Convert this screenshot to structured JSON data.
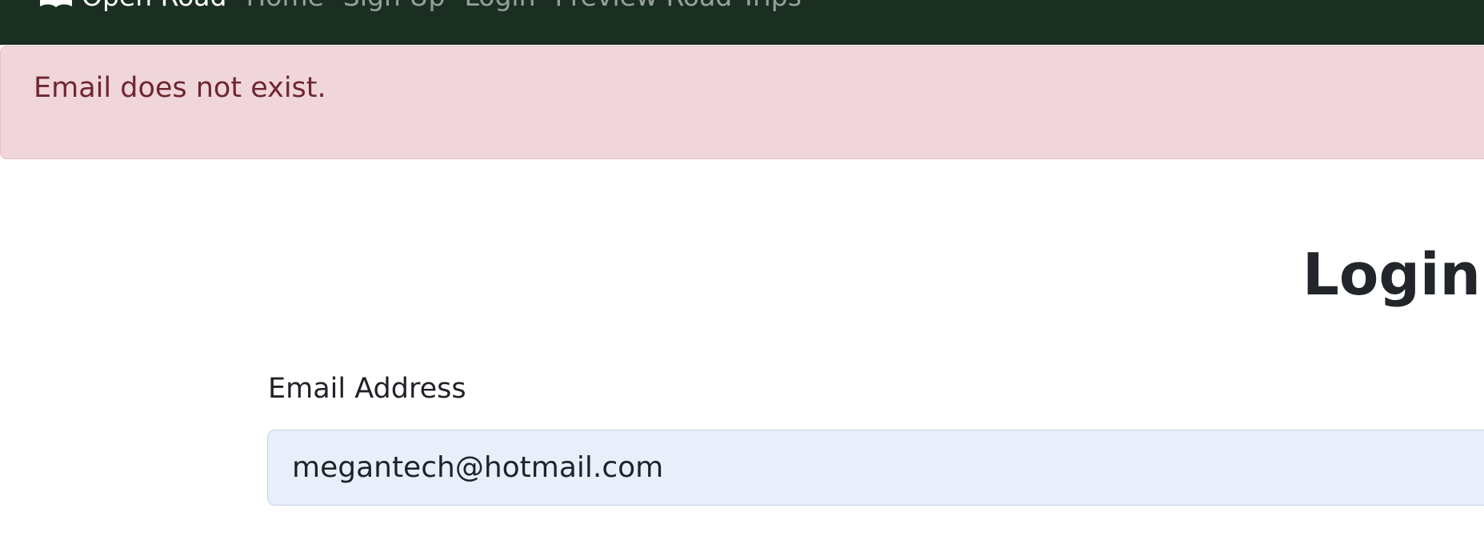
{
  "navbar": {
    "brand": "Open Road",
    "links": [
      "Home",
      "Sign Up",
      "Login",
      "Preview Road Trips"
    ],
    "background": "#1b2e22"
  },
  "alert": {
    "message": "Email does not exist.",
    "background": "#f0d6da",
    "text_color": "#6e2631"
  },
  "page": {
    "title": "Login"
  },
  "form": {
    "email_label": "Email Address",
    "email_value": "megantech@hotmail.com"
  }
}
